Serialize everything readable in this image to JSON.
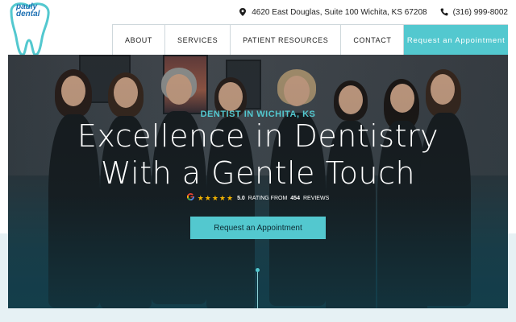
{
  "brand": {
    "logo_line1": "pauly",
    "logo_line2": "dental",
    "color": "#1b6fb3"
  },
  "contact": {
    "address": "4620 East Douglas, Suite 100 Wichita, KS 67208",
    "address_icon": "map-pin-icon",
    "phone": "(316) 999-8002",
    "phone_icon": "phone-icon"
  },
  "nav": {
    "items": [
      {
        "label": "ABOUT"
      },
      {
        "label": "SERVICES"
      },
      {
        "label": "PATIENT RESOURCES"
      },
      {
        "label": "CONTACT"
      }
    ],
    "cta": "Request an Appointment"
  },
  "hero": {
    "eyebrow": "DENTIST IN WICHITA, KS",
    "headline_line1": "Excellence in Dentistry",
    "headline_line2": "With a Gentle Touch",
    "rating": {
      "stars": "★★★★★",
      "score": "5.0",
      "text_mid": "RATING FROM",
      "count": "454",
      "text_end": "REVIEWS",
      "google_glyph": "G"
    },
    "cta": "Request an Appointment"
  },
  "colors": {
    "accent": "#53c8cf",
    "star": "#f5b400"
  }
}
